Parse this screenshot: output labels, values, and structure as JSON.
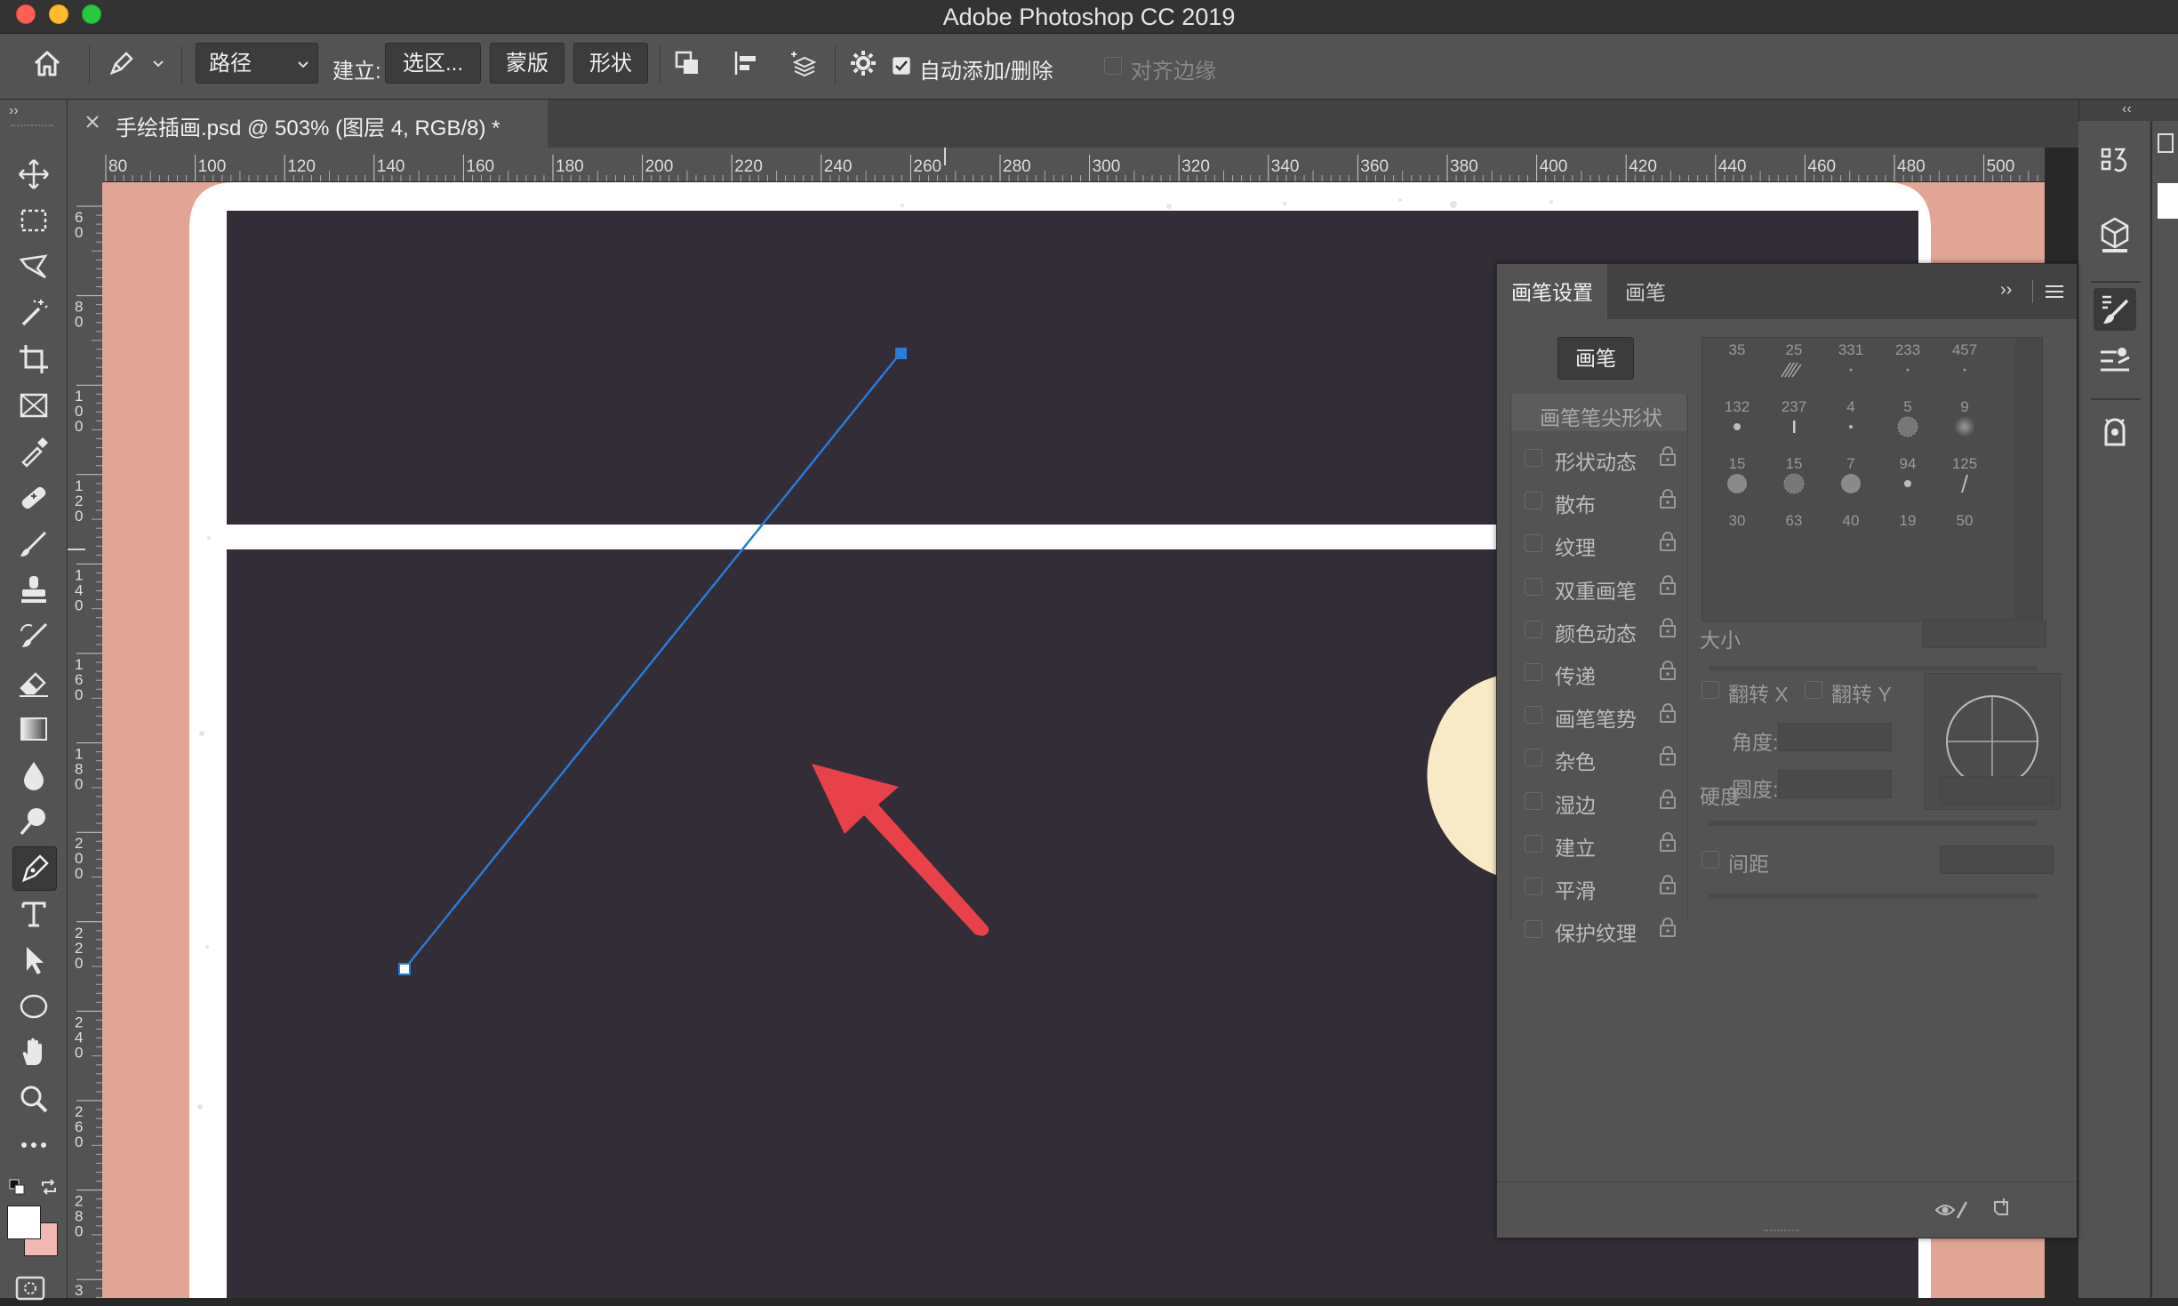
{
  "window": {
    "title": "Adobe Photoshop CC 2019"
  },
  "options_bar": {
    "path_mode": "路径",
    "make_label": "建立:",
    "selection_button": "选区...",
    "mask_button": "蒙版",
    "shape_button": "形状",
    "auto_add_delete_label": "自动添加/删除",
    "auto_add_delete_checked": true,
    "align_edges_label": "对齐边缘",
    "align_edges_checked": false
  },
  "document": {
    "tab_title": "手绘插画.psd @ 503% (图层 4, RGB/8) *",
    "zoom_percent": 503
  },
  "rulers": {
    "horizontal": [
      "80",
      "100",
      "120",
      "140",
      "160",
      "180",
      "200",
      "220",
      "240",
      "260",
      "280",
      "300",
      "320",
      "340",
      "360",
      "380",
      "400",
      "420",
      "440",
      "460",
      "480",
      "500"
    ],
    "vertical": [
      [
        "6",
        "0"
      ],
      [
        "8",
        "0"
      ],
      [
        "1",
        "0",
        "0"
      ],
      [
        "1",
        "2",
        "0"
      ],
      [
        "1",
        "4",
        "0"
      ],
      [
        "1",
        "6",
        "0"
      ],
      [
        "1",
        "8",
        "0"
      ],
      [
        "2",
        "0",
        "0"
      ],
      [
        "2",
        "2",
        "0"
      ],
      [
        "2",
        "4",
        "0"
      ],
      [
        "2",
        "6",
        "0"
      ],
      [
        "2",
        "8",
        "0"
      ],
      [
        "3"
      ]
    ]
  },
  "colors": {
    "canvas_background": "#e1a596",
    "dark_panel": "#332d37",
    "frame_white": "#ffffff",
    "moon": "#f8eac6",
    "path_stroke": "#2a7ad6",
    "annotation_arrow": "#e8414a",
    "foreground_color": "#ffffff",
    "background_color": "#f2b9b4"
  },
  "brush_panel": {
    "tabs": [
      "画笔设置",
      "画笔"
    ],
    "active_tab": "画笔设置",
    "brush_button": "画笔",
    "tip_shape_label": "画笔笔尖形状",
    "options": [
      {
        "label": "形状动态"
      },
      {
        "label": "散布"
      },
      {
        "label": "纹理"
      },
      {
        "label": "双重画笔"
      },
      {
        "label": "颜色动态"
      },
      {
        "label": "传递"
      },
      {
        "label": "画笔笔势"
      },
      {
        "label": "杂色"
      },
      {
        "label": "湿边"
      },
      {
        "label": "建立"
      },
      {
        "label": "平滑"
      },
      {
        "label": "保护纹理"
      }
    ],
    "presets": [
      {
        "size": "35",
        "kind": "none"
      },
      {
        "size": "25",
        "kind": "scribble"
      },
      {
        "size": "331",
        "kind": "dot"
      },
      {
        "size": "233",
        "kind": "dot"
      },
      {
        "size": "457",
        "kind": "dot"
      },
      {
        "size": "132",
        "kind": "smalldot"
      },
      {
        "size": "237",
        "kind": "bar"
      },
      {
        "size": "4",
        "kind": "tiny"
      },
      {
        "size": "5",
        "kind": "texture"
      },
      {
        "size": "9",
        "kind": "soft"
      },
      {
        "size": "15",
        "kind": "round"
      },
      {
        "size": "15",
        "kind": "texture"
      },
      {
        "size": "7",
        "kind": "round"
      },
      {
        "size": "94",
        "kind": "smalldot"
      },
      {
        "size": "125",
        "kind": "slash"
      },
      {
        "size": "30",
        "kind": "none"
      },
      {
        "size": "63",
        "kind": "none"
      },
      {
        "size": "40",
        "kind": "none"
      },
      {
        "size": "19",
        "kind": "none"
      },
      {
        "size": "50",
        "kind": "none"
      }
    ],
    "size_label": "大小",
    "flip_x_label": "翻转 X",
    "flip_y_label": "翻转 Y",
    "angle_label": "角度:",
    "roundness_label": "圆度:",
    "hardness_label": "硬度",
    "spacing_label": "间距"
  }
}
